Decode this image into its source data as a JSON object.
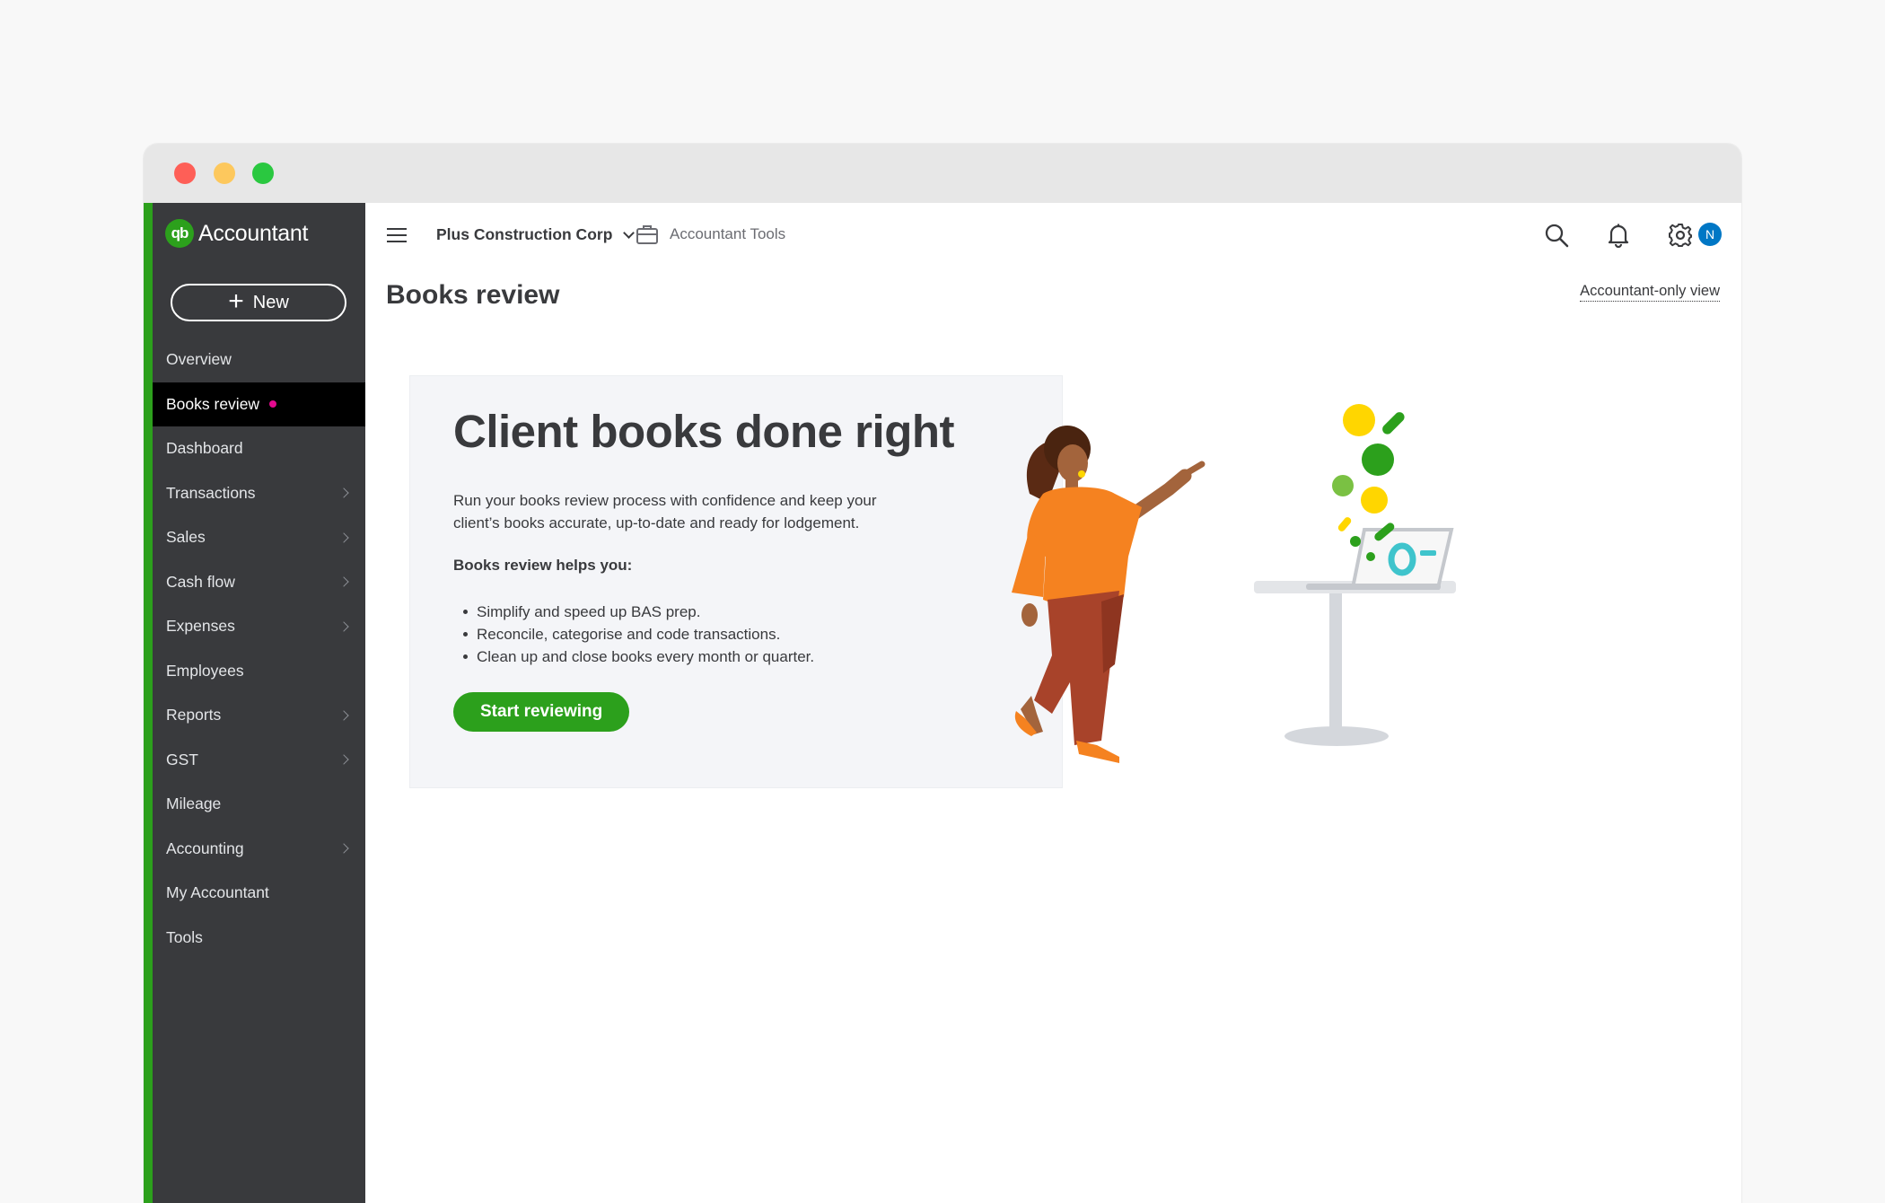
{
  "app": {
    "logo_mark": "qb",
    "logo_text": "Accountant",
    "brand_color": "#2ca01c"
  },
  "sidebar": {
    "new_button": "New",
    "items": [
      {
        "label": "Overview",
        "has_submenu": false
      },
      {
        "label": "Books review",
        "has_submenu": false,
        "active": true,
        "badge": "pink-dot"
      },
      {
        "label": "Dashboard",
        "has_submenu": false
      },
      {
        "label": "Transactions",
        "has_submenu": true
      },
      {
        "label": "Sales",
        "has_submenu": true
      },
      {
        "label": "Cash flow",
        "has_submenu": true
      },
      {
        "label": "Expenses",
        "has_submenu": true
      },
      {
        "label": "Employees",
        "has_submenu": false
      },
      {
        "label": "Reports",
        "has_submenu": true
      },
      {
        "label": "GST",
        "has_submenu": true
      },
      {
        "label": "Mileage",
        "has_submenu": false
      },
      {
        "label": "Accounting",
        "has_submenu": true
      },
      {
        "label": "My Accountant",
        "has_submenu": false
      },
      {
        "label": "Tools",
        "has_submenu": false
      }
    ]
  },
  "topbar": {
    "company": "Plus Construction Corp",
    "accountant_tools": "Accountant Tools",
    "icons": [
      "search-icon",
      "bell-icon",
      "gear-icon"
    ],
    "avatar_initial": "N",
    "avatar_color": "#0077c5"
  },
  "page": {
    "title": "Books review",
    "view_link": "Accountant-only view"
  },
  "card": {
    "heading": "Client books done right",
    "description": "Run your books review process with confidence and keep your client’s books accurate, up-to-date and ready for lodgement.",
    "helps_heading": "Books review helps you:",
    "bullets": [
      "Simplify and speed up BAS prep.",
      "Reconcile, categorise and code transactions.",
      "Clean up and close books every month or quarter."
    ],
    "cta": "Start reviewing"
  }
}
